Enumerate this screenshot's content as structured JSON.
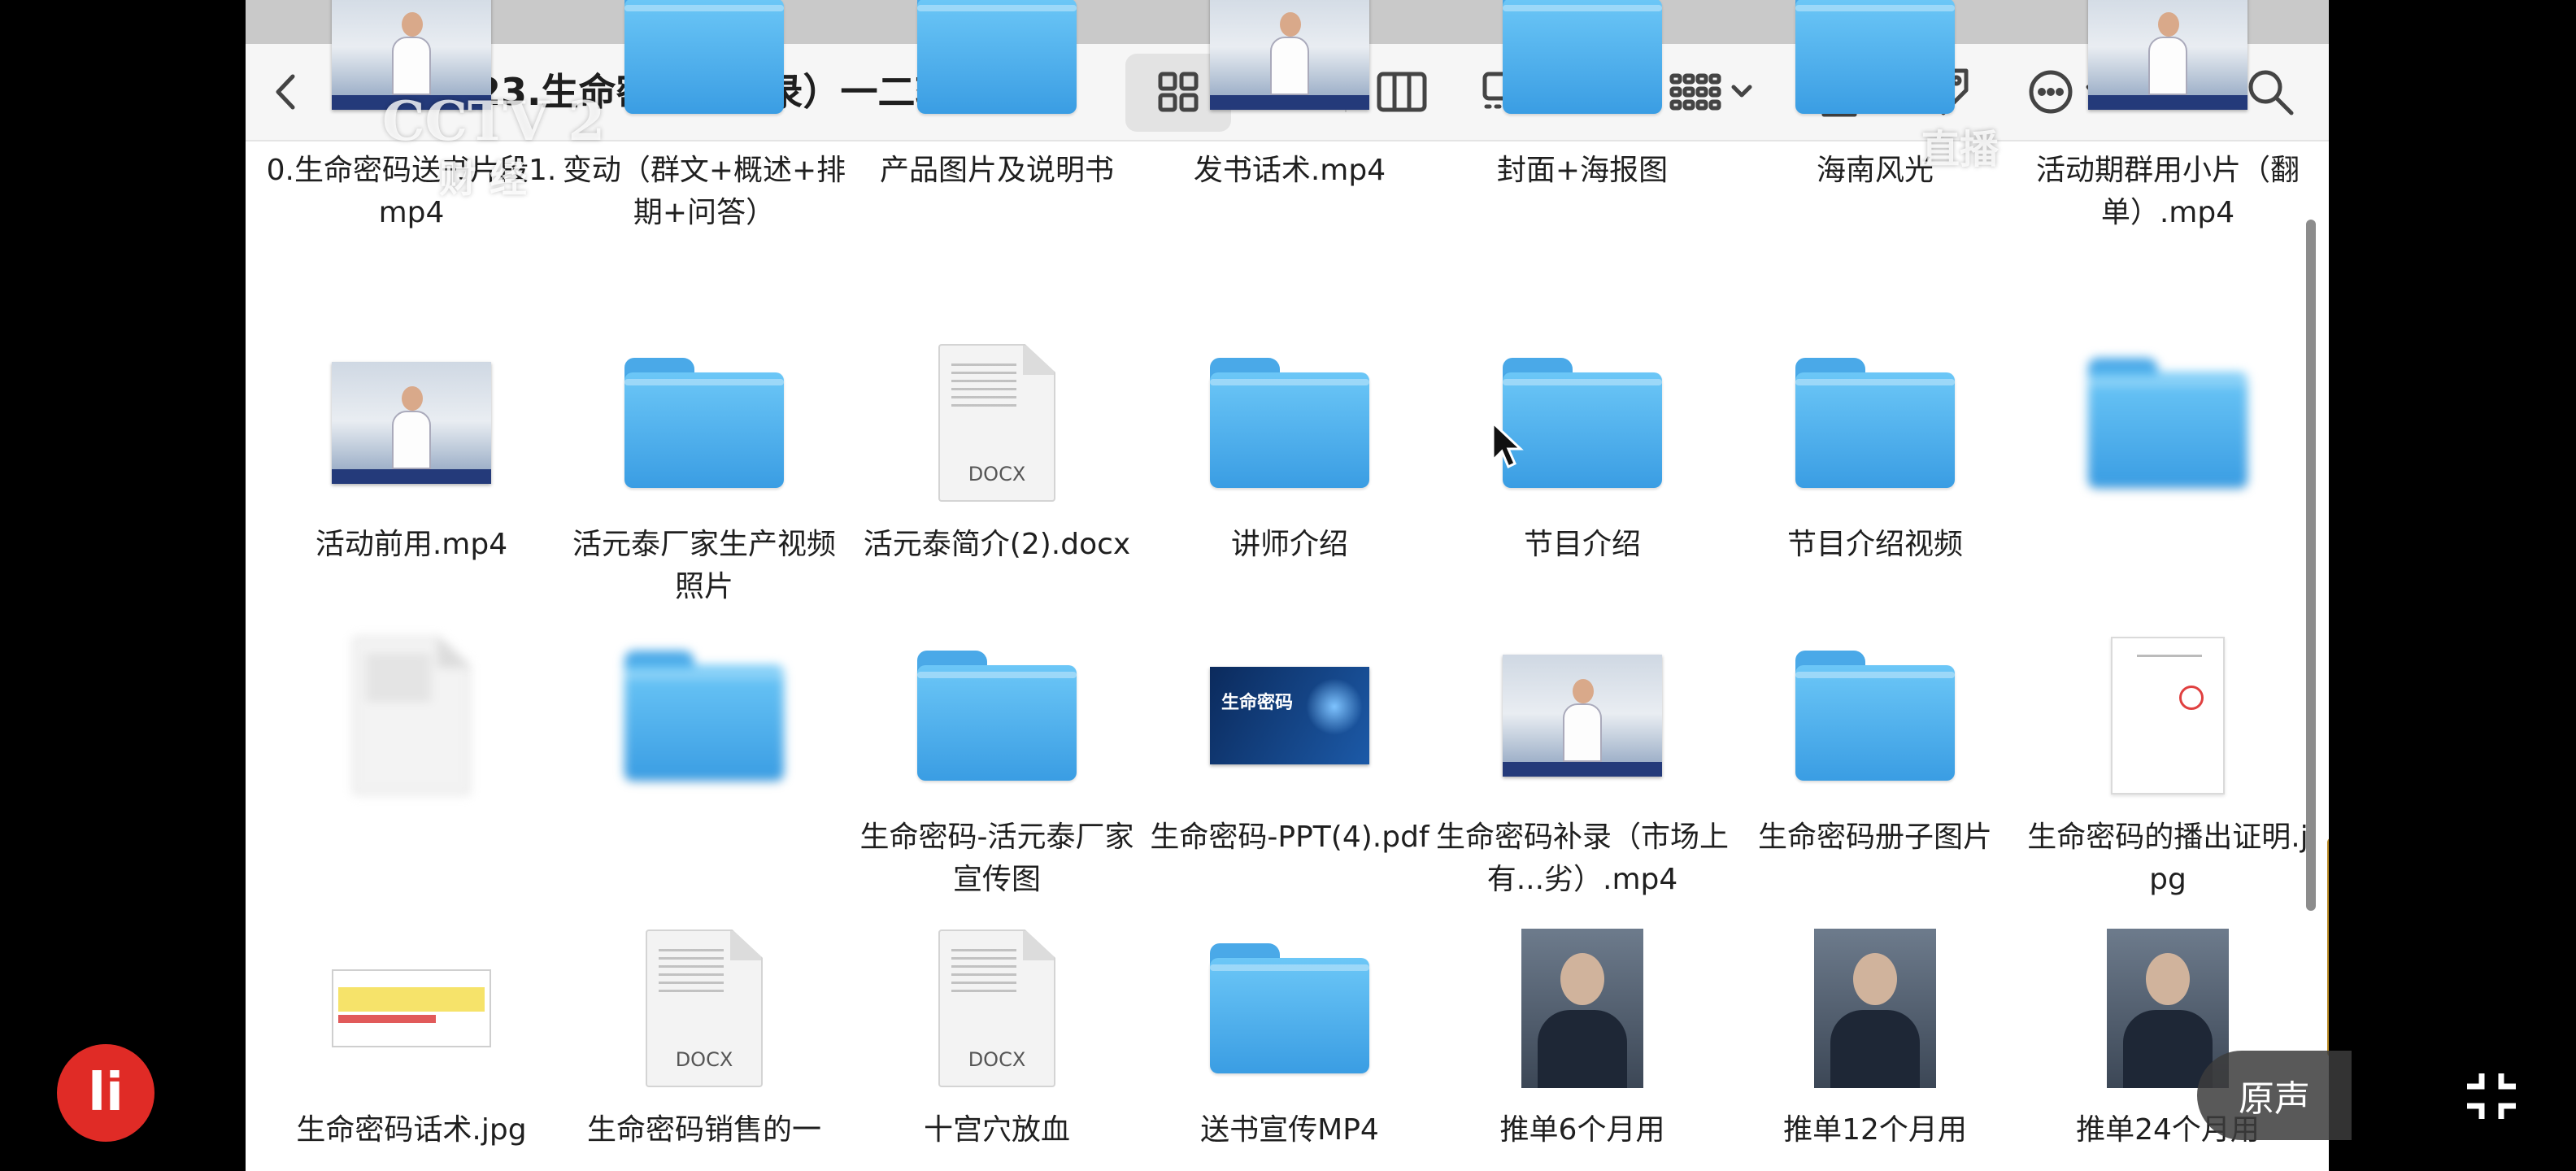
{
  "window": {
    "title": "23.生命密码（重录）一二轮所有..."
  },
  "watermarks": {
    "channel": "CCTV 2",
    "channel_sub": "财 经",
    "live": "直播"
  },
  "overlay": {
    "logo": "li",
    "original_sound": "原声"
  },
  "files": [
    {
      "name": "0.生命密码送书片段1.mp4",
      "kind": "video"
    },
    {
      "name": "变动（群文+概述+排期+问答）",
      "kind": "folder"
    },
    {
      "name": "产品图片及说明书",
      "kind": "folder"
    },
    {
      "name": "发书话术.mp4",
      "kind": "video"
    },
    {
      "name": "封面+海报图",
      "kind": "folder"
    },
    {
      "name": "海南风光",
      "kind": "folder"
    },
    {
      "name": "活动期群用小片（翻单）.mp4",
      "kind": "video"
    },
    {
      "name": "活动前用.mp4",
      "kind": "video"
    },
    {
      "name": "活元泰厂家生产视频 照片",
      "kind": "folder"
    },
    {
      "name": "活元泰简介(2).docx",
      "kind": "docx",
      "ext": "DOCX"
    },
    {
      "name": "讲师介绍",
      "kind": "folder"
    },
    {
      "name": "节目介绍",
      "kind": "folder"
    },
    {
      "name": "节目介绍视频",
      "kind": "folder"
    },
    {
      "name": "",
      "kind": "folder",
      "blurred": true
    },
    {
      "name": "",
      "kind": "doc",
      "blurred": true
    },
    {
      "name": "",
      "kind": "folder",
      "blurred": true
    },
    {
      "name": "生命密码-活元泰厂家宣传图",
      "kind": "folder"
    },
    {
      "name": "生命密码-PPT(4).pdf",
      "kind": "pdf",
      "thumb_text": "生命密码"
    },
    {
      "name": "生命密码补录（市场上有...劣）.mp4",
      "kind": "video"
    },
    {
      "name": "生命密码册子图片",
      "kind": "folder"
    },
    {
      "name": "生命密码的播出证明.jpg",
      "kind": "paper"
    },
    {
      "name": "生命密码话术.jpg",
      "kind": "sheet"
    },
    {
      "name": "生命密码销售的一",
      "kind": "docx",
      "ext": "DOCX"
    },
    {
      "name": "十宫穴放血",
      "kind": "docx",
      "ext": "DOCX"
    },
    {
      "name": "送书宣传MP4",
      "kind": "folder"
    },
    {
      "name": "推单6个月用",
      "kind": "photo"
    },
    {
      "name": "推单12个月用",
      "kind": "photo"
    },
    {
      "name": "推单24个月用",
      "kind": "photo"
    }
  ]
}
